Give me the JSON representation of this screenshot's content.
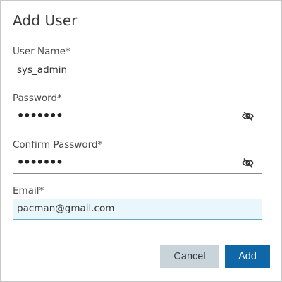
{
  "dialog": {
    "title": "Add User"
  },
  "fields": {
    "user_name": {
      "label": "User Name*",
      "value": "sys_admin"
    },
    "password": {
      "label": "Password*",
      "value": "•••••••",
      "toggle_icon": "eye-slash-icon"
    },
    "confirm_password": {
      "label": "Confirm Password*",
      "value": "•••••••",
      "toggle_icon": "eye-slash-icon"
    },
    "email": {
      "label": "Email*",
      "value": "pacman@gmail.com"
    }
  },
  "buttons": {
    "cancel_label": "Cancel",
    "add_label": "Add"
  },
  "colors": {
    "primary_button": "#0f67a8",
    "secondary_button": "#c8d4da",
    "active_field_bg": "#e9f6fb"
  }
}
